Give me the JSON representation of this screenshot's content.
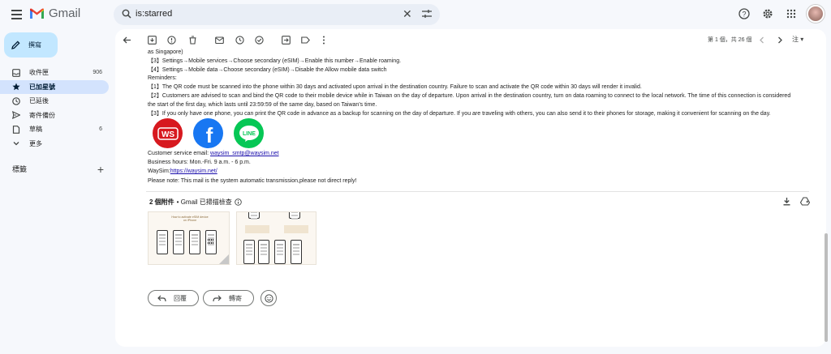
{
  "app": {
    "name": "Gmail"
  },
  "search": {
    "value": "is:starred"
  },
  "compose": {
    "label": "撰寫"
  },
  "sidebar": {
    "items": [
      {
        "label": "收件匣",
        "count": "906",
        "icon": "inbox-icon"
      },
      {
        "label": "已加星號",
        "count": "",
        "icon": "star-icon",
        "active": true
      },
      {
        "label": "已延後",
        "count": "",
        "icon": "clock-icon"
      },
      {
        "label": "寄件備份",
        "count": "",
        "icon": "send-icon"
      },
      {
        "label": "草稿",
        "count": "6",
        "icon": "draft-icon"
      },
      {
        "label": "更多",
        "count": "",
        "icon": "chevron-down-icon"
      }
    ],
    "labels_title": "標籤"
  },
  "toolbar": {
    "pager": "第 1 個，共 26 個",
    "lang": "注"
  },
  "email": {
    "lines": [
      "as Singapore)",
      "【3】Settings→Mobile services→Choose secondary (eSIM)→Enable this number→Enable roaming.",
      "【4】Settings→Mobile data→Choose secondary (eSIM)→Disable the Allow mobile data switch",
      "Reminders:",
      "【1】The QR code must be scanned into the phone within 30 days and activated upon arrival in the destination country. Failure to scan and activate the QR code within 30 days will render it invalid.",
      "【2】Customers are advised to scan and bind the QR code to their mobile device while in Taiwan on the day of departure. Upon arrival in the destination country, turn on data roaming to connect to the local network. The time of this connection is considered the start of the first day, which lasts until 23:59:59 of the same day, based on Taiwan's time.",
      "【3】If you only have one phone, you can print the QR code in advance as a backup for scanning on the day of departure. If you are traveling with others, you can also send it to their phones for storage, making it convenient for scanning on the day."
    ],
    "socials": [
      {
        "name": "waysim-logo",
        "text": "WS",
        "color": "#d7191f"
      },
      {
        "name": "facebook-logo",
        "text": "f",
        "color": "#1877f2"
      },
      {
        "name": "line-logo",
        "text": "LINE",
        "color": "#06c755"
      }
    ],
    "contact": {
      "email_label": "Customer service email: ",
      "email": "waysim_smtp@waysim.net",
      "hours": "Business hours: Mon.-Fri. 9 a.m. - 6 p.m.",
      "site_label": "WaySim:",
      "site": "https://waysim.net/",
      "note": "Please note: This mail is the system automatic transmission,please not direct reply!"
    }
  },
  "attachments": {
    "count_label": "2 個附件",
    "scan_label": "• Gmail 已掃描檢查",
    "thumb1_caption": "How to activate eSIM device on iPhone"
  },
  "actions": {
    "reply": "回覆",
    "forward": "轉寄"
  }
}
